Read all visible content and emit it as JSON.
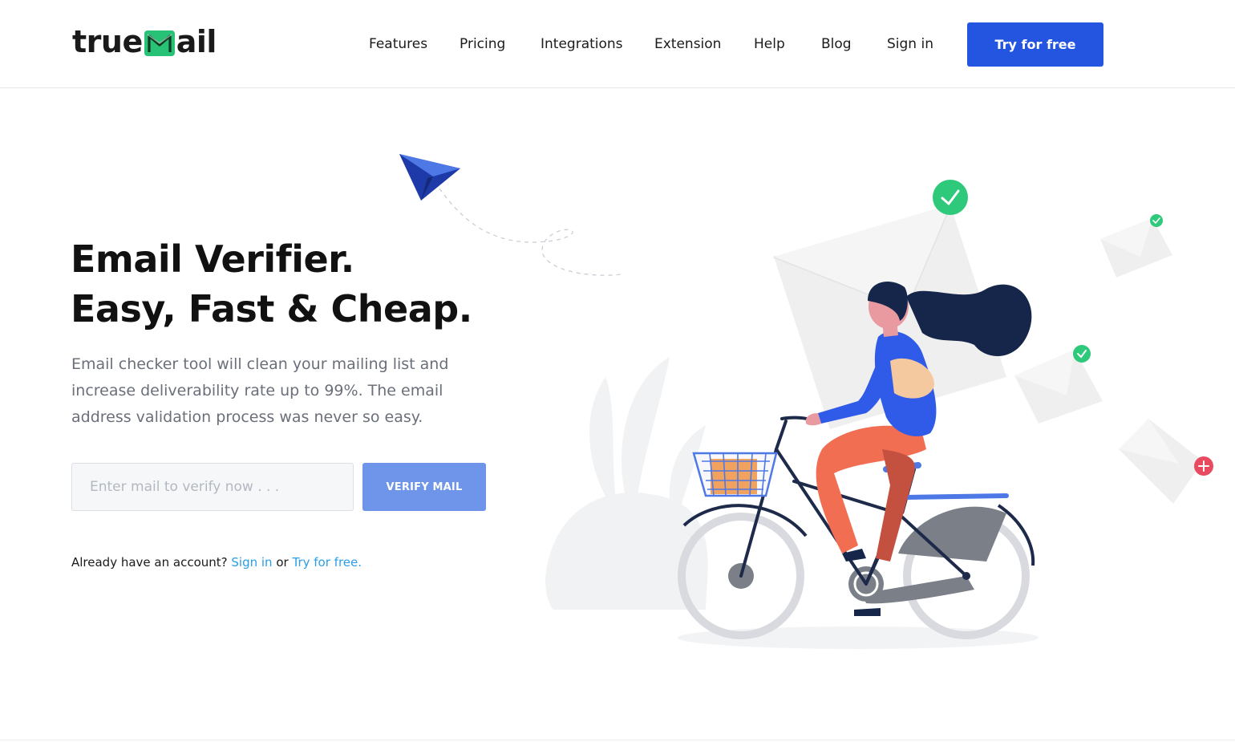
{
  "header": {
    "logo_prefix": "true",
    "logo_suffix": "ail",
    "nav": [
      {
        "label": "Features"
      },
      {
        "label": "Pricing"
      },
      {
        "label": "Integrations"
      },
      {
        "label": "Extension"
      },
      {
        "label": "Help"
      },
      {
        "label": "Blog"
      },
      {
        "label": "Sign in"
      }
    ],
    "cta_label": "Try for free"
  },
  "hero": {
    "title_line1": "Email Verifier.",
    "title_line2": "Easy, Fast & Cheap.",
    "description": "Email checker tool will clean your mailing list and increase deliverability rate up to 99%. The email address validation process was never so easy.",
    "input_placeholder": "Enter mail to verify now . . .",
    "input_value": "",
    "verify_label": "VERIFY MAIL",
    "account_text": "Already have an account?",
    "signin_link": "Sign in",
    "or_text": "or",
    "try_link": "Try for free."
  },
  "colors": {
    "brand_blue": "#2355e0",
    "verify_button": "#6e95ea",
    "logo_green": "#27c275",
    "link_blue": "#2a9ee8",
    "success_green": "#2ec97a",
    "error_red": "#e84a5f"
  },
  "icons": {
    "logo_mark": "envelope-m-icon",
    "paper_plane": "paper-plane-icon",
    "check": "check-icon",
    "plus": "plus-icon"
  }
}
